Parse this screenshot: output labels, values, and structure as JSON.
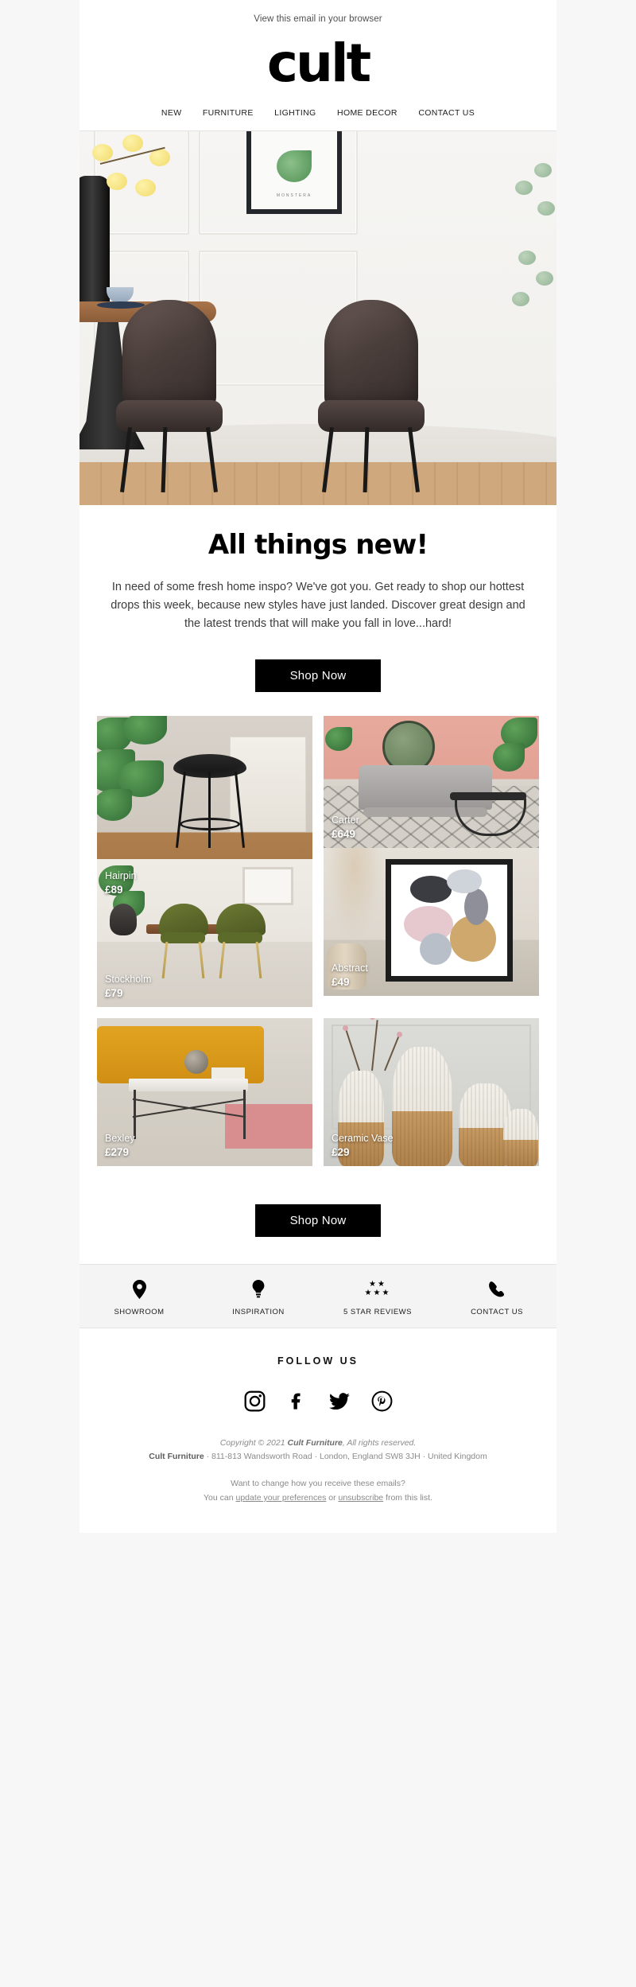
{
  "preheader": {
    "text": "View this email in your browser"
  },
  "brand": {
    "logo_text": "cult"
  },
  "nav": {
    "items": [
      {
        "label": "NEW"
      },
      {
        "label": "FURNITURE"
      },
      {
        "label": "LIGHTING"
      },
      {
        "label": "HOME DECOR"
      },
      {
        "label": "CONTACT US"
      }
    ]
  },
  "hero": {
    "alt": "dining room with two brown leather chairs and round table"
  },
  "intro": {
    "heading": "All things new!",
    "body": "In need of some fresh home inspo? We've got you. Get ready to shop our hottest drops this week, because new styles have just landed. Discover great design and the latest trends that will make you fall in love...hard!"
  },
  "cta_top": {
    "label": "Shop Now"
  },
  "cta_bottom": {
    "label": "Shop Now"
  },
  "products": [
    {
      "name": "Hairpin",
      "price": "£89"
    },
    {
      "name": "Carter",
      "price": "£649"
    },
    {
      "name": "Stockholm",
      "price": "£79"
    },
    {
      "name": "Abstract",
      "price": "£49"
    },
    {
      "name": "Bexley",
      "price": "£279"
    },
    {
      "name": "Ceramic Vase",
      "price": "£29"
    }
  ],
  "features": [
    {
      "label": "SHOWROOM",
      "icon": "location-pin-icon"
    },
    {
      "label": "INSPIRATION",
      "icon": "lightbulb-icon"
    },
    {
      "label": "5 STAR REVIEWS",
      "icon": "five-stars-icon"
    },
    {
      "label": "CONTACT US",
      "icon": "phone-icon"
    }
  ],
  "follow": {
    "title": "FOLLOW US",
    "socials": [
      {
        "name": "instagram-icon"
      },
      {
        "name": "facebook-icon"
      },
      {
        "name": "twitter-icon"
      },
      {
        "name": "pinterest-icon"
      }
    ]
  },
  "footer": {
    "copyright_pre": "Copyright © 2021 ",
    "copyright_brand": "Cult Furniture",
    "copyright_post": ", All rights reserved.",
    "company": "Cult Furniture",
    "address": " · 811-813 Wandsworth Road · London, England SW8 3JH · United Kingdom",
    "prefs_question": "Want to change how you receive these emails?",
    "prefs_prefix": "You can ",
    "prefs_link": "update your preferences",
    "prefs_middle": " or ",
    "unsub_link": "unsubscribe",
    "prefs_suffix": " from this list."
  },
  "colors": {
    "accent": "#000000",
    "page_bg": "#f7f7f7",
    "feature_bg": "#f4f4f4"
  }
}
